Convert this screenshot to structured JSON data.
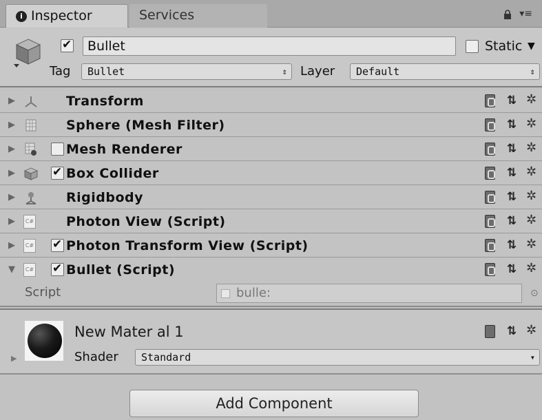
{
  "tabs": {
    "inspector": "Inspector",
    "services": "Services",
    "menu_glyph": "▾≡"
  },
  "object": {
    "active": true,
    "name": "Bullet",
    "static_label": "Static",
    "static_checked": false,
    "tag_label": "Tag",
    "tag_value": "Bullet",
    "layer_label": "Layer",
    "layer_value": "Default"
  },
  "components": [
    {
      "title": "Transform",
      "icon": "transform-icon",
      "checkbox": null
    },
    {
      "title": "Sphere (Mesh Filter)",
      "icon": "mesh-filter-icon",
      "checkbox": null
    },
    {
      "title": "Mesh Renderer",
      "icon": "mesh-renderer-icon",
      "checkbox": false
    },
    {
      "title": "Box Collider",
      "icon": "box-collider-icon",
      "checkbox": true
    },
    {
      "title": "Rigidbody",
      "icon": "rigidbody-icon",
      "checkbox": null
    },
    {
      "title": "Photon View (Script)",
      "icon": "csharp-script-icon",
      "checkbox": null
    },
    {
      "title": "Photon Transform View (Script)",
      "icon": "csharp-script-icon",
      "checkbox": true
    },
    {
      "title": "Bullet (Script)",
      "icon": "csharp-script-icon",
      "checkbox": true,
      "expanded": true
    }
  ],
  "script_field": {
    "label": "Script",
    "value": "bulle:"
  },
  "material": {
    "name": "New Mater al 1",
    "shader_label": "Shader",
    "shader_value": "Standard"
  },
  "add_component_label": "Add Component",
  "glyphs": {
    "fold_closed": "▶",
    "fold_open": "▼",
    "gear": "✲",
    "preset": "⇅",
    "dropdown_arrows": "⇕",
    "dropdown_arrow": "▾",
    "static_arrow": "▼",
    "target": "⊙"
  },
  "colors": {
    "panel_bg": "#c2c2c2",
    "tab_strip": "#a9a9a9",
    "active_tab": "#d0d0d0",
    "row_border": "#9a9a9a"
  }
}
